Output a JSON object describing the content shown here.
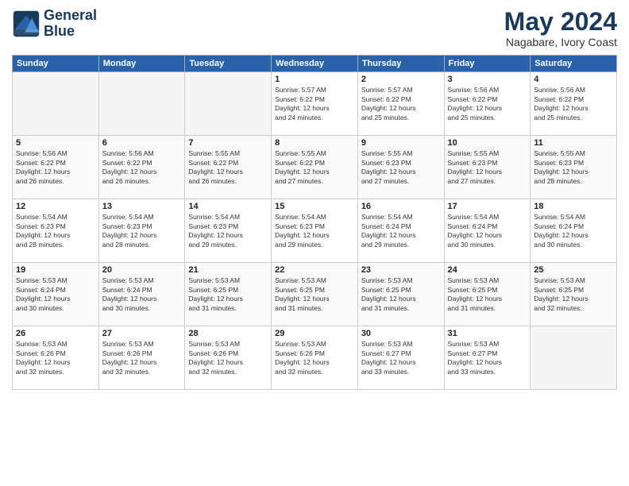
{
  "header": {
    "logo_line1": "General",
    "logo_line2": "Blue",
    "month_year": "May 2024",
    "location": "Nagabare, Ivory Coast"
  },
  "weekdays": [
    "Sunday",
    "Monday",
    "Tuesday",
    "Wednesday",
    "Thursday",
    "Friday",
    "Saturday"
  ],
  "weeks": [
    [
      {
        "day": "",
        "info": ""
      },
      {
        "day": "",
        "info": ""
      },
      {
        "day": "",
        "info": ""
      },
      {
        "day": "1",
        "info": "Sunrise: 5:57 AM\nSunset: 6:22 PM\nDaylight: 12 hours\nand 24 minutes."
      },
      {
        "day": "2",
        "info": "Sunrise: 5:57 AM\nSunset: 6:22 PM\nDaylight: 12 hours\nand 25 minutes."
      },
      {
        "day": "3",
        "info": "Sunrise: 5:56 AM\nSunset: 6:22 PM\nDaylight: 12 hours\nand 25 minutes."
      },
      {
        "day": "4",
        "info": "Sunrise: 5:56 AM\nSunset: 6:22 PM\nDaylight: 12 hours\nand 25 minutes."
      }
    ],
    [
      {
        "day": "5",
        "info": "Sunrise: 5:56 AM\nSunset: 6:22 PM\nDaylight: 12 hours\nand 26 minutes."
      },
      {
        "day": "6",
        "info": "Sunrise: 5:56 AM\nSunset: 6:22 PM\nDaylight: 12 hours\nand 26 minutes."
      },
      {
        "day": "7",
        "info": "Sunrise: 5:55 AM\nSunset: 6:22 PM\nDaylight: 12 hours\nand 26 minutes."
      },
      {
        "day": "8",
        "info": "Sunrise: 5:55 AM\nSunset: 6:22 PM\nDaylight: 12 hours\nand 27 minutes."
      },
      {
        "day": "9",
        "info": "Sunrise: 5:55 AM\nSunset: 6:23 PM\nDaylight: 12 hours\nand 27 minutes."
      },
      {
        "day": "10",
        "info": "Sunrise: 5:55 AM\nSunset: 6:23 PM\nDaylight: 12 hours\nand 27 minutes."
      },
      {
        "day": "11",
        "info": "Sunrise: 5:55 AM\nSunset: 6:23 PM\nDaylight: 12 hours\nand 28 minutes."
      }
    ],
    [
      {
        "day": "12",
        "info": "Sunrise: 5:54 AM\nSunset: 6:23 PM\nDaylight: 12 hours\nand 28 minutes."
      },
      {
        "day": "13",
        "info": "Sunrise: 5:54 AM\nSunset: 6:23 PM\nDaylight: 12 hours\nand 28 minutes."
      },
      {
        "day": "14",
        "info": "Sunrise: 5:54 AM\nSunset: 6:23 PM\nDaylight: 12 hours\nand 29 minutes."
      },
      {
        "day": "15",
        "info": "Sunrise: 5:54 AM\nSunset: 6:23 PM\nDaylight: 12 hours\nand 29 minutes."
      },
      {
        "day": "16",
        "info": "Sunrise: 5:54 AM\nSunset: 6:24 PM\nDaylight: 12 hours\nand 29 minutes."
      },
      {
        "day": "17",
        "info": "Sunrise: 5:54 AM\nSunset: 6:24 PM\nDaylight: 12 hours\nand 30 minutes."
      },
      {
        "day": "18",
        "info": "Sunrise: 5:54 AM\nSunset: 6:24 PM\nDaylight: 12 hours\nand 30 minutes."
      }
    ],
    [
      {
        "day": "19",
        "info": "Sunrise: 5:53 AM\nSunset: 6:24 PM\nDaylight: 12 hours\nand 30 minutes."
      },
      {
        "day": "20",
        "info": "Sunrise: 5:53 AM\nSunset: 6:24 PM\nDaylight: 12 hours\nand 30 minutes."
      },
      {
        "day": "21",
        "info": "Sunrise: 5:53 AM\nSunset: 6:25 PM\nDaylight: 12 hours\nand 31 minutes."
      },
      {
        "day": "22",
        "info": "Sunrise: 5:53 AM\nSunset: 6:25 PM\nDaylight: 12 hours\nand 31 minutes."
      },
      {
        "day": "23",
        "info": "Sunrise: 5:53 AM\nSunset: 6:25 PM\nDaylight: 12 hours\nand 31 minutes."
      },
      {
        "day": "24",
        "info": "Sunrise: 5:53 AM\nSunset: 6:25 PM\nDaylight: 12 hours\nand 31 minutes."
      },
      {
        "day": "25",
        "info": "Sunrise: 5:53 AM\nSunset: 6:25 PM\nDaylight: 12 hours\nand 32 minutes."
      }
    ],
    [
      {
        "day": "26",
        "info": "Sunrise: 5:53 AM\nSunset: 6:26 PM\nDaylight: 12 hours\nand 32 minutes."
      },
      {
        "day": "27",
        "info": "Sunrise: 5:53 AM\nSunset: 6:26 PM\nDaylight: 12 hours\nand 32 minutes."
      },
      {
        "day": "28",
        "info": "Sunrise: 5:53 AM\nSunset: 6:26 PM\nDaylight: 12 hours\nand 32 minutes."
      },
      {
        "day": "29",
        "info": "Sunrise: 5:53 AM\nSunset: 6:26 PM\nDaylight: 12 hours\nand 32 minutes."
      },
      {
        "day": "30",
        "info": "Sunrise: 5:53 AM\nSunset: 6:27 PM\nDaylight: 12 hours\nand 33 minutes."
      },
      {
        "day": "31",
        "info": "Sunrise: 5:53 AM\nSunset: 6:27 PM\nDaylight: 12 hours\nand 33 minutes."
      },
      {
        "day": "",
        "info": ""
      }
    ]
  ]
}
